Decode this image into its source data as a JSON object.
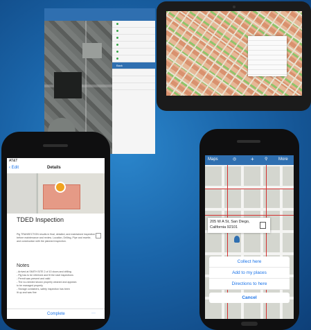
{
  "tablet_left": {
    "panel_header": "Back",
    "panel_rows": [
      "",
      "",
      "",
      "",
      "",
      "",
      "",
      ""
    ]
  },
  "phone_left": {
    "carrier": "AT&T",
    "nav_back": "Edit",
    "nav_title": "Details",
    "record_title": "TDED Inspection",
    "record_subtitle": "",
    "badge": "",
    "description": "Pig TRANSECTION results in final, detailed, and maintained inspection before maintenance and review. Location, Drilling, Pipe and rewrite, and construction with the planned inspection.",
    "notes_heading": "Notes",
    "notes_text": "- Arrived at SMITH SITE 2 of 10 doors and drilling\n- Pig has to be retrieved and fit the start inspections\n- Permit was present and valid\n- The no-needed shown properly cleaned and appears\n  to be managed properly\n- Storage containers, safety inspection has been\n  lit up and was fine",
    "bottom_action": "Complete",
    "bottom_more": "···"
  },
  "phone_right": {
    "toolbar_left": "Maps",
    "toolbar_right": "More",
    "callout_line1": "205 W A St, San Diego,",
    "callout_line2": "California 92101",
    "actions": [
      "Collect here",
      "Add to my places",
      "Directions to here"
    ],
    "cancel": "Cancel"
  }
}
